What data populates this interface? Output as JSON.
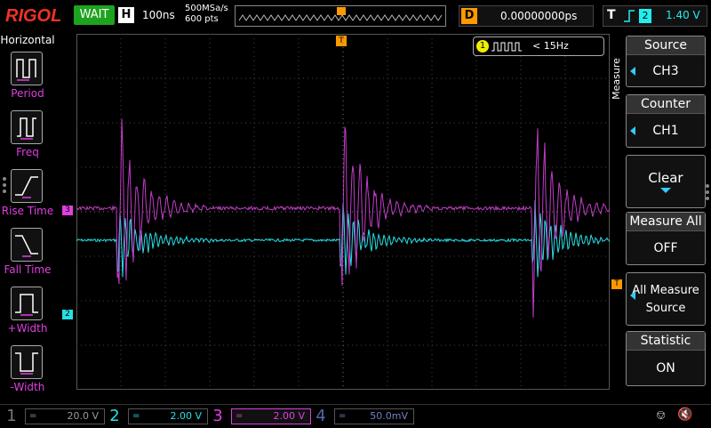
{
  "topbar": {
    "logo": "RIGOL",
    "run_state": "WAIT",
    "timebase_key": "H",
    "timebase": "100ns",
    "sample_rate": "500MSa/s",
    "mem_depth": "600 pts",
    "delay_key": "D",
    "delay": "0.00000000ps",
    "trigger_key": "T",
    "trigger_channel": "2",
    "trigger_level": "1.40 V"
  },
  "left_panel": {
    "title": "Horizontal",
    "items": [
      {
        "label": "Period",
        "icon": "period-icon"
      },
      {
        "label": "Freq",
        "icon": "frequency-icon"
      },
      {
        "label": "Rise Time",
        "icon": "rise-time-icon"
      },
      {
        "label": "Fall Time",
        "icon": "fall-time-icon"
      },
      {
        "label": "+Width",
        "icon": "positive-width-icon"
      },
      {
        "label": "-Width",
        "icon": "negative-width-icon"
      }
    ]
  },
  "screen": {
    "measurement_channel": "1",
    "measurement_text": "< 15Hz",
    "ch3_marker": "3",
    "ch2_marker": "2",
    "trigger_marker": "T"
  },
  "right_panel": {
    "title": "Measure",
    "source_label": "Source",
    "source_value": "CH3",
    "counter_label": "Counter",
    "counter_value": "CH1",
    "clear_label": "Clear",
    "measure_all_label": "Measure All",
    "measure_all_value": "OFF",
    "all_measure_line1": "All Measure",
    "all_measure_line2": "Source",
    "statistic_label": "Statistic",
    "statistic_value": "ON"
  },
  "channels": [
    {
      "num": "1",
      "coupling": "=",
      "scale": "20.0 V",
      "color": "#777777"
    },
    {
      "num": "2",
      "coupling": "=",
      "scale": "2.00 V",
      "color": "#27e0e6"
    },
    {
      "num": "3",
      "coupling": "=",
      "scale": "2.00 V",
      "color": "#e03ee0"
    },
    {
      "num": "4",
      "coupling": "=",
      "scale": "50.0mV",
      "color": "#5566aa"
    }
  ],
  "colors": {
    "ch2": "#27e0e6",
    "ch3": "#e03ee0",
    "trigger": "#ff9900",
    "run": "#1ea31e",
    "logo": "#e33322"
  }
}
